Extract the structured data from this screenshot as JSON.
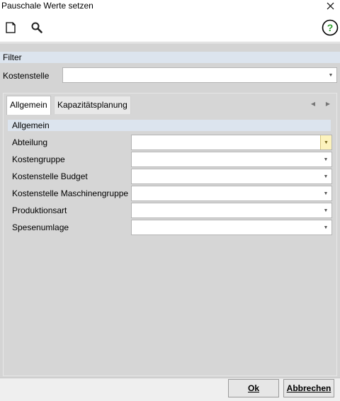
{
  "window": {
    "title": "Pauschale Werte setzen",
    "close_icon": "close-icon"
  },
  "toolbar": {
    "new_icon": "new-document-icon",
    "search_icon": "search-icon",
    "help_icon": "help-icon",
    "help_glyph": "?"
  },
  "filter": {
    "header": "Filter",
    "kostenstelle_label": "Kostenstelle",
    "kostenstelle_value": ""
  },
  "tabs": [
    {
      "label": "Allgemein",
      "active": true
    },
    {
      "label": "Kapazitätsplanung",
      "active": false
    }
  ],
  "section": {
    "header": "Allgemein",
    "rows": [
      {
        "label": "Abteilung",
        "value": ""
      },
      {
        "label": "Kostengruppe",
        "value": ""
      },
      {
        "label": "Kostenstelle Budget",
        "value": ""
      },
      {
        "label": "Kostenstelle Maschinengruppe",
        "value": ""
      },
      {
        "label": "Produktionsart",
        "value": ""
      },
      {
        "label": "Spesenumlage",
        "value": ""
      }
    ]
  },
  "buttons": {
    "ok": "Ok",
    "cancel": "Abbrechen"
  },
  "colors": {
    "panel_bg": "#d4d4d4",
    "header_bg": "#dce4ee",
    "help_green": "#2e9e2e",
    "highlight_arrow": "#fdf3bd"
  }
}
